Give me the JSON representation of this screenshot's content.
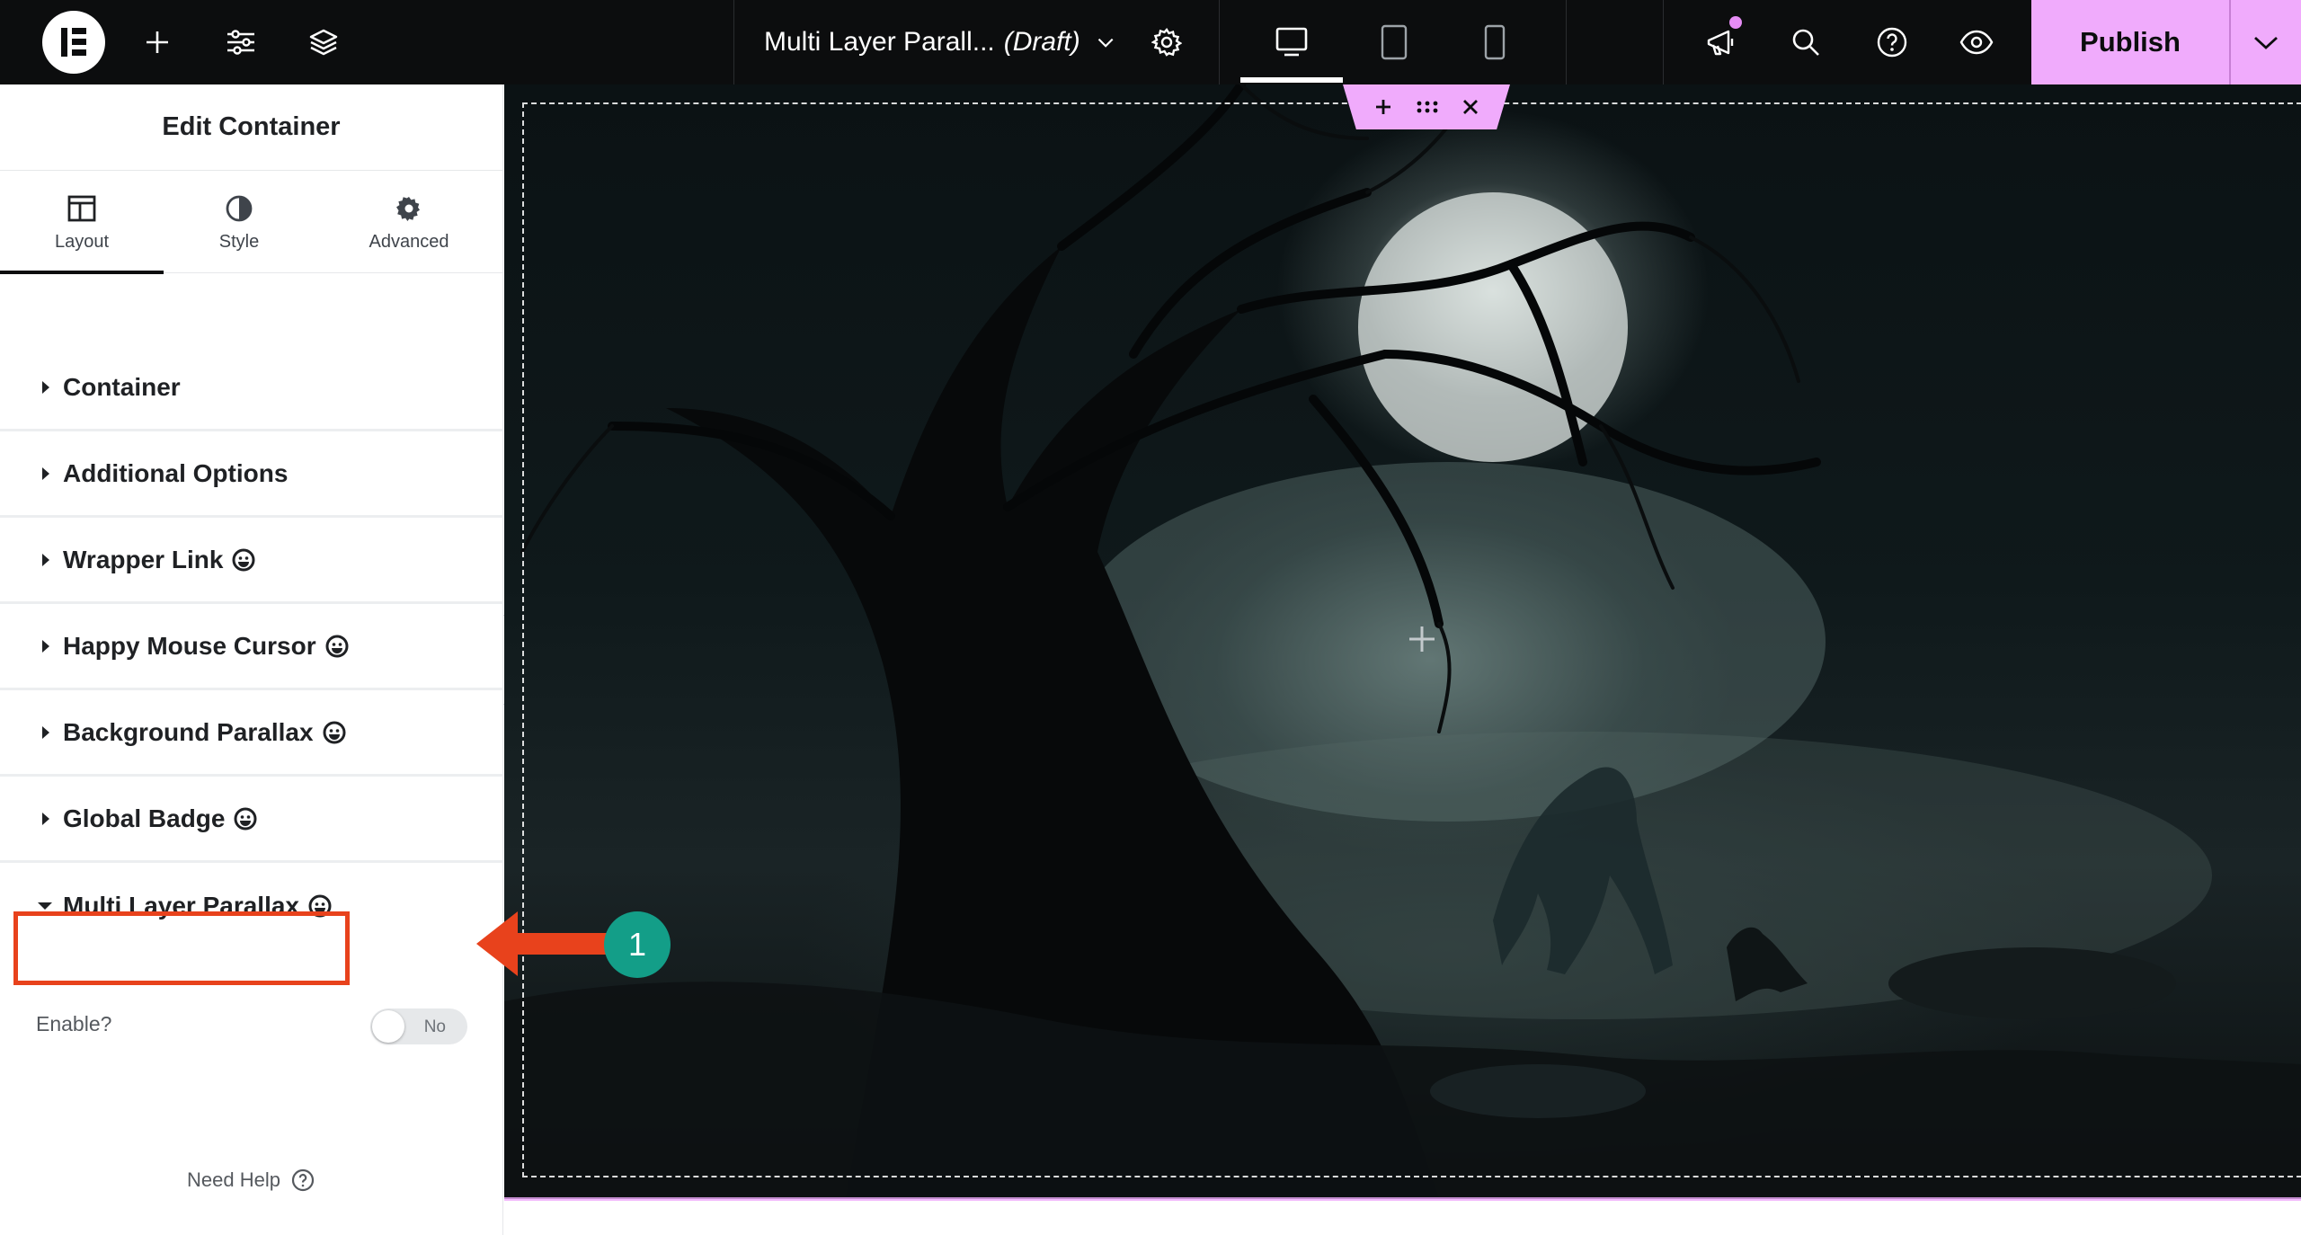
{
  "topbar": {
    "document_title": "Multi Layer Parall...",
    "document_status": "(Draft)",
    "publish_label": "Publish",
    "icons": [
      "elementor-logo-icon",
      "plus-icon",
      "sliders-icon",
      "layers-icon",
      "chevron-down-icon",
      "gear-icon",
      "desktop-icon",
      "tablet-icon",
      "mobile-icon",
      "megaphone-icon",
      "search-icon",
      "help-icon",
      "eye-icon",
      "chevron-down-icon"
    ],
    "active_device": "desktop",
    "accent_color": "#f0abfc"
  },
  "panel": {
    "title": "Edit Container",
    "tabs": [
      {
        "label": "Layout",
        "icon": "columns-icon",
        "active": true
      },
      {
        "label": "Style",
        "icon": "half-circle-icon",
        "active": false
      },
      {
        "label": "Advanced",
        "icon": "gear-icon",
        "active": false
      }
    ],
    "sections": [
      {
        "label": "Container",
        "expanded": false,
        "badge": false
      },
      {
        "label": "Additional Options",
        "expanded": false,
        "badge": false
      },
      {
        "label": "Wrapper Link",
        "expanded": false,
        "badge": true
      },
      {
        "label": "Happy Mouse Cursor",
        "expanded": false,
        "badge": true
      },
      {
        "label": "Background Parallax",
        "expanded": false,
        "badge": true
      },
      {
        "label": "Global Badge",
        "expanded": false,
        "badge": true
      },
      {
        "label": "Multi Layer Parallax",
        "expanded": true,
        "badge": true
      }
    ],
    "enable_label": "Enable?",
    "enable_toggle": "No",
    "need_help_label": "Need Help"
  },
  "annotation": {
    "step_number": "1",
    "highlight_color": "#e8421c",
    "step_color": "#139e88"
  }
}
